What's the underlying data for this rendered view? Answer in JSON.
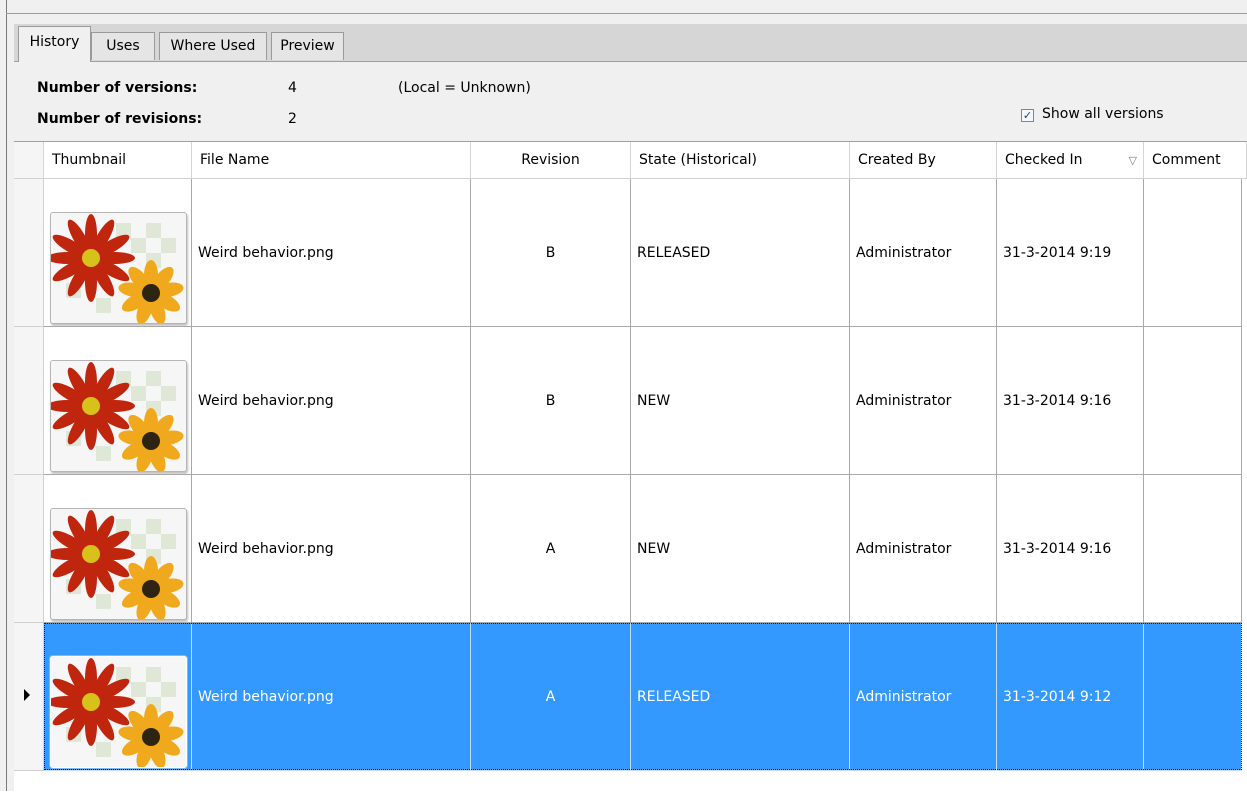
{
  "tabs": [
    {
      "label": "History",
      "active": true
    },
    {
      "label": "Uses",
      "active": false
    },
    {
      "label": "Where Used",
      "active": false
    },
    {
      "label": "Preview",
      "active": false
    }
  ],
  "summary": {
    "versions_label": "Number of versions:",
    "versions_value": "4",
    "revisions_label": "Number of revisions:",
    "revisions_value": "2",
    "local_status": "(Local = Unknown)"
  },
  "show_all_versions": {
    "label": "Show all versions",
    "checked": true,
    "mark": "✓"
  },
  "columns": {
    "thumbnail": "Thumbnail",
    "file_name": "File Name",
    "revision": "Revision",
    "state": "State (Historical)",
    "created_by": "Created By",
    "checked_in": "Checked In",
    "comment": "Comment"
  },
  "sort_indicator": "▽",
  "rows": [
    {
      "file_name": "Weird behavior.png",
      "revision": "B",
      "state": "RELEASED",
      "created_by": "Administrator",
      "checked_in": "31-3-2014 9:19",
      "comment": "",
      "selected": false
    },
    {
      "file_name": "Weird behavior.png",
      "revision": "B",
      "state": "NEW",
      "created_by": "Administrator",
      "checked_in": "31-3-2014 9:16",
      "comment": "",
      "selected": false
    },
    {
      "file_name": "Weird behavior.png",
      "revision": "A",
      "state": "NEW",
      "created_by": "Administrator",
      "checked_in": "31-3-2014 9:16",
      "comment": "",
      "selected": false
    },
    {
      "file_name": "Weird behavior.png",
      "revision": "A",
      "state": "RELEASED",
      "created_by": "Administrator",
      "checked_in": "31-3-2014 9:12",
      "comment": "",
      "selected": true
    }
  ],
  "colors": {
    "selection": "#3399ff",
    "tabstrip": "#d6d6d6",
    "panel": "#f0f0f0"
  }
}
